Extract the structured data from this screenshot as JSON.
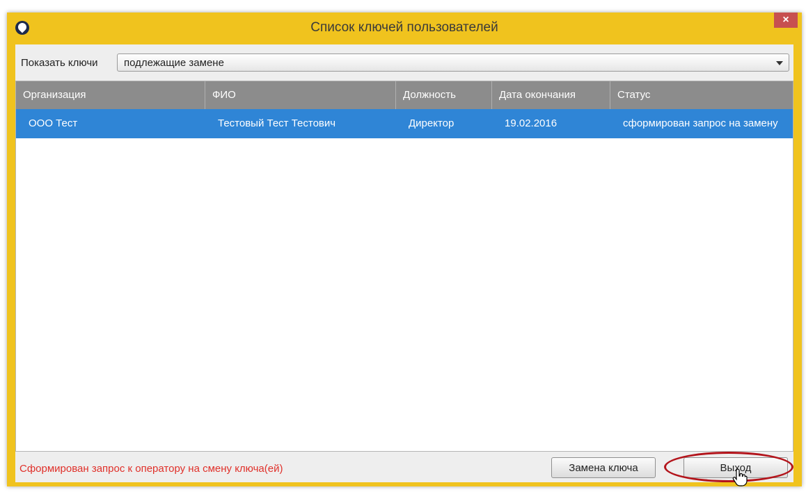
{
  "window": {
    "title": "Список ключей пользователей",
    "close_label": "×"
  },
  "filter": {
    "label": "Показать ключи",
    "selected": "подлежащие замене"
  },
  "table": {
    "columns": [
      "Организация",
      "ФИО",
      "Должность",
      "Дата окончания",
      "Статус"
    ],
    "rows": [
      {
        "organization": "ООО Тест",
        "name": "Тестовый Тест Тестович",
        "position": "Директор",
        "end_date": "19.02.2016",
        "status": "сформирован запрос на замену"
      }
    ],
    "selected_row": 0
  },
  "footer": {
    "status_message": "Сформирован запрос к оператору на смену ключа(ей)",
    "replace_button": "Замена ключа",
    "exit_button": "Выход"
  },
  "colors": {
    "window_frame": "#f0c31e",
    "header_bg": "#8c8c8c",
    "selection": "#2f85d6",
    "status_text": "#e0302a",
    "highlight_ring": "#b3141b"
  }
}
